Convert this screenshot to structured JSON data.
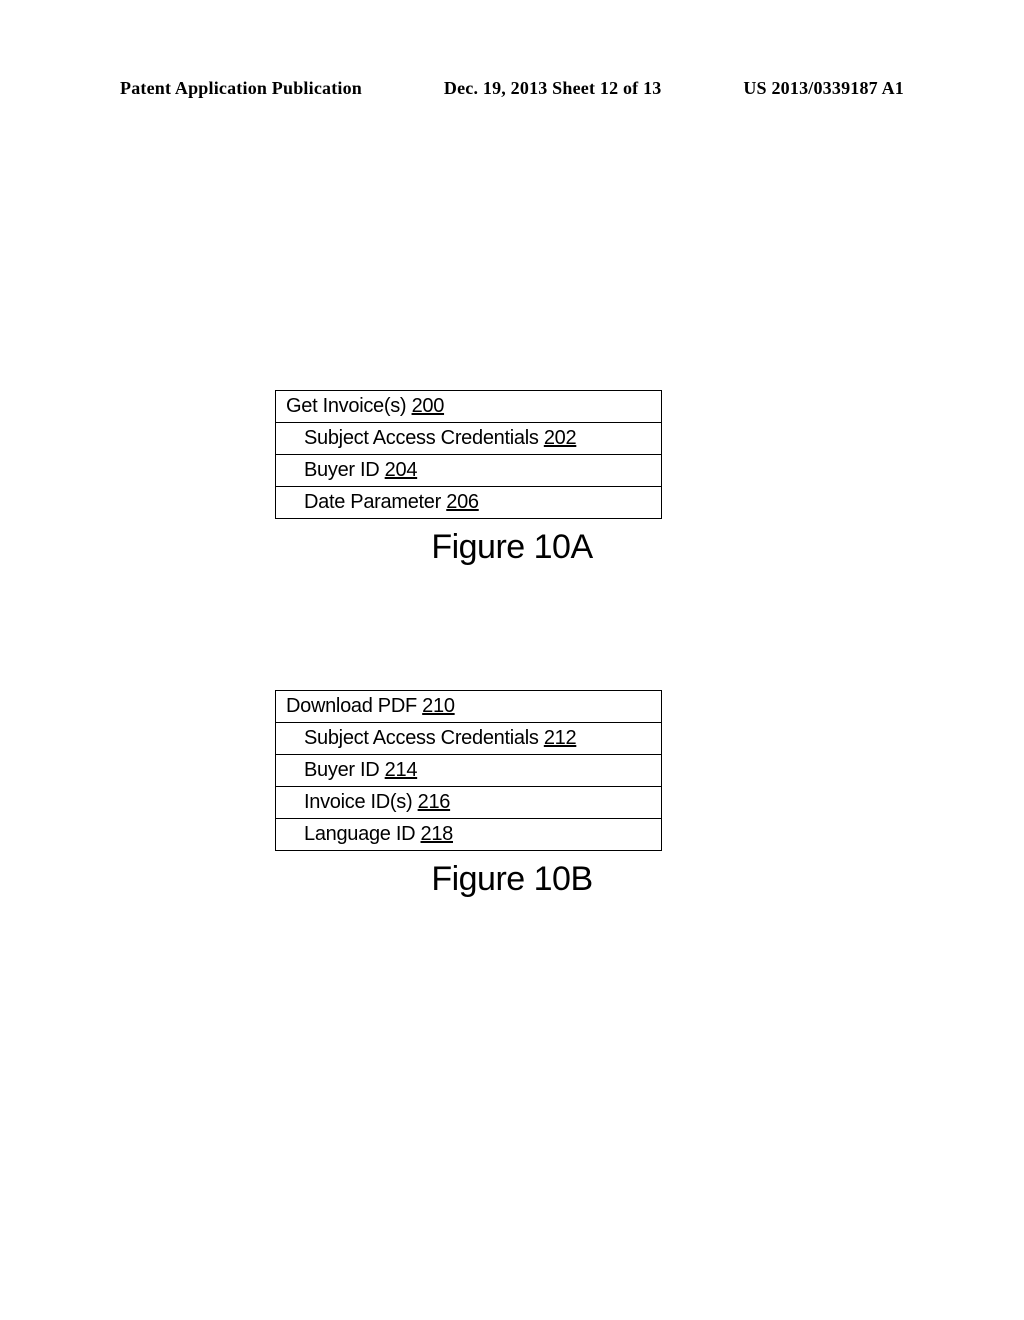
{
  "header": {
    "publication": "Patent Application Publication",
    "date_sheet": "Dec. 19, 2013  Sheet 12 of 13",
    "pub_number": "US 2013/0339187 A1"
  },
  "figure_a": {
    "title_text": "Get Invoice(s)",
    "title_ref": "200",
    "rows": [
      {
        "text": "Subject Access Credentials",
        "ref": "202"
      },
      {
        "text": "Buyer ID",
        "ref": "204"
      },
      {
        "text": "Date Parameter",
        "ref": "206"
      }
    ],
    "caption": "Figure 10A"
  },
  "figure_b": {
    "title_text": "Download PDF",
    "title_ref": "210",
    "rows": [
      {
        "text": "Subject Access Credentials",
        "ref": "212"
      },
      {
        "text": "Buyer ID",
        "ref": "214"
      },
      {
        "text": "Invoice ID(s)",
        "ref": "216"
      },
      {
        "text": "Language ID",
        "ref": "218"
      }
    ],
    "caption": "Figure 10B"
  }
}
